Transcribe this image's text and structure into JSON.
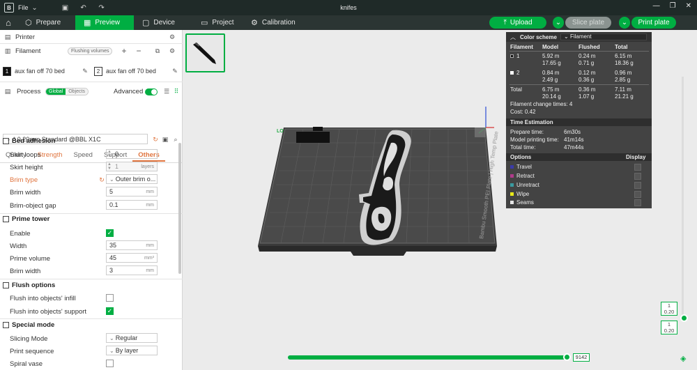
{
  "titlebar": {
    "menu_label": "File",
    "window_title": "knifes"
  },
  "toolbar": {
    "tabs": [
      {
        "label": "Prepare",
        "icon": "cube-icon"
      },
      {
        "label": "Preview",
        "icon": "preview-icon"
      },
      {
        "label": "Device",
        "icon": "device-icon"
      },
      {
        "label": "Project",
        "icon": "project-icon"
      },
      {
        "label": "Calibration",
        "icon": "calibration-icon"
      }
    ],
    "upload_label": "Upload",
    "slice_label": "Slice plate",
    "print_label": "Print plate",
    "accent": "#00ae42"
  },
  "sidebar": {
    "printer_label": "Printer",
    "filament_label": "Filament",
    "flushing_label": "Flushing volumes",
    "filaments": [
      {
        "num": "1",
        "name": "aux fan off 70 bed",
        "color": "#111111"
      },
      {
        "num": "2",
        "name": "aux fan off 70 bed",
        "color": "#ffffff"
      }
    ],
    "process_label": "Process",
    "global_label": "Global",
    "objects_label": "Objects",
    "advanced_label": "Advanced",
    "preset_value": "* 0.20mm Standard @BBL X1C",
    "subtabs": [
      "Quality",
      "Strength",
      "Speed",
      "Support",
      "Others"
    ],
    "bed_adhesion": {
      "title": "Bed adhesion",
      "skirt_loops_label": "Skirt loops",
      "skirt_loops": "0",
      "skirt_height_label": "Skirt height",
      "skirt_height": "1",
      "skirt_height_unit": "layers",
      "brim_type_label": "Brim type",
      "brim_type": "Outer brim o...",
      "brim_width_label": "Brim width",
      "brim_width": "5",
      "brim_width_unit": "mm",
      "brim_gap_label": "Brim-object gap",
      "brim_gap": "0.1",
      "brim_gap_unit": "mm"
    },
    "prime_tower": {
      "title": "Prime tower",
      "enable_label": "Enable",
      "enable": true,
      "width_label": "Width",
      "width": "35",
      "width_unit": "mm",
      "volume_label": "Prime volume",
      "volume": "45",
      "volume_unit": "mm³",
      "brim_width_label": "Brim width",
      "brim_width": "3",
      "brim_width_unit": "mm"
    },
    "flush_options": {
      "title": "Flush options",
      "infill_label": "Flush into objects' infill",
      "infill": false,
      "support_label": "Flush into objects' support",
      "support": true
    },
    "special_mode": {
      "title": "Special mode",
      "slicing_mode_label": "Slicing Mode",
      "slicing_mode": "Regular",
      "print_seq_label": "Print sequence",
      "print_seq": "By layer",
      "spiral_label": "Spiral vase"
    }
  },
  "viewport": {
    "plate_text": "Bambu Smooth PEI Plate | High Temp Plate",
    "plate_corner_label": "LO"
  },
  "legend": {
    "scheme_label": "Color scheme",
    "scheme_value": "Filament",
    "headers": [
      "Filament",
      "Model",
      "Flushed",
      "Total"
    ],
    "rows": [
      {
        "id": "1",
        "color": "#111111",
        "model": [
          "5.92 m",
          "17.65 g"
        ],
        "flushed": [
          "0.24 m",
          "0.71 g"
        ],
        "total": [
          "6.15 m",
          "18.36 g"
        ]
      },
      {
        "id": "2",
        "color": "#ffffff",
        "model": [
          "0.84 m",
          "2.49 g"
        ],
        "flushed": [
          "0.12 m",
          "0.36 g"
        ],
        "total": [
          "0.96 m",
          "2.85 g"
        ]
      }
    ],
    "total_label": "Total",
    "total": {
      "model": [
        "6.75 m",
        "20.14 g"
      ],
      "flushed": [
        "0.36 m",
        "1.07 g"
      ],
      "total": [
        "7.11 m",
        "21.21 g"
      ]
    },
    "change_times": "Filament change times:  4",
    "cost": "Cost:  0.42",
    "time_title": "Time Estimation",
    "prepare_label": "Prepare time:",
    "prepare_time": "6m30s",
    "model_time_label": "Model printing time:",
    "model_time": "41m14s",
    "total_time_label": "Total time:",
    "total_time": "47m44s",
    "options_label": "Options",
    "display_label": "Display",
    "options": [
      {
        "name": "Travel",
        "color": "#3a3aa8"
      },
      {
        "name": "Retract",
        "color": "#b03a8a"
      },
      {
        "name": "Unretract",
        "color": "#3a9aa0"
      },
      {
        "name": "Wipe",
        "color": "#e8e81a"
      },
      {
        "name": "Seams",
        "color": "#e6e6e6"
      }
    ]
  },
  "layer_slider": {
    "top_layer": "1",
    "top_height": "0.20",
    "bottom_layer": "1",
    "bottom_height": "0.20"
  },
  "move_slider": {
    "value": "9142",
    "position": 1.0
  }
}
